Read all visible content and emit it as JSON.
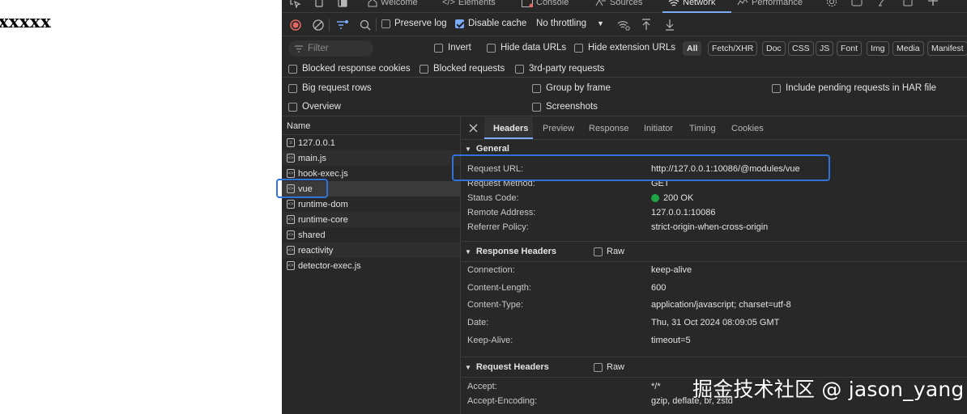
{
  "page": {
    "text": "xxxxx"
  },
  "devtools": {
    "tabs": [
      {
        "label": "Welcome",
        "icon": "home-icon"
      },
      {
        "label": "Elements",
        "icon": "code-icon"
      },
      {
        "label": "Console",
        "icon": "console-icon"
      },
      {
        "label": "Sources",
        "icon": "sources-icon"
      },
      {
        "label": "Network",
        "icon": "wifi-icon",
        "active": true
      },
      {
        "label": "Performance",
        "icon": "performance-icon"
      }
    ],
    "toolbar": {
      "preserve_log": "Preserve log",
      "disable_cache": "Disable cache",
      "throttling": "No throttling"
    },
    "filter": {
      "placeholder": "Filter",
      "invert": "Invert",
      "hide_data_urls": "Hide data URLs",
      "hide_extension_urls": "Hide extension URLs",
      "types": [
        "All",
        "Fetch/XHR",
        "Doc",
        "CSS",
        "JS",
        "Font",
        "Img",
        "Media",
        "Manifest"
      ],
      "blocked_response_cookies": "Blocked response cookies",
      "blocked_requests": "Blocked requests",
      "third_party_requests": "3rd-party requests"
    },
    "settings": {
      "big_request_rows": "Big request rows",
      "group_by_frame": "Group by frame",
      "include_pending": "Include pending requests in HAR file",
      "overview": "Overview",
      "screenshots": "Screenshots"
    },
    "requests": {
      "header": "Name",
      "items": [
        "127.0.0.1",
        "main.js",
        "hook-exec.js",
        "vue",
        "runtime-dom",
        "runtime-core",
        "shared",
        "reactivity",
        "detector-exec.js"
      ]
    },
    "details": {
      "tabs": [
        "Headers",
        "Preview",
        "Response",
        "Initiator",
        "Timing",
        "Cookies"
      ],
      "general": {
        "title": "General",
        "rows": [
          {
            "k": "Request URL:",
            "v": "http://127.0.0.1:10086/@modules/vue"
          },
          {
            "k": "Request Method:",
            "v": "GET"
          },
          {
            "k": "Status Code:",
            "v": "200 OK"
          },
          {
            "k": "Remote Address:",
            "v": "127.0.0.1:10086"
          },
          {
            "k": "Referrer Policy:",
            "v": "strict-origin-when-cross-origin"
          }
        ]
      },
      "response_headers": {
        "title": "Response Headers",
        "raw": "Raw",
        "rows": [
          {
            "k": "Connection:",
            "v": "keep-alive"
          },
          {
            "k": "Content-Length:",
            "v": "600"
          },
          {
            "k": "Content-Type:",
            "v": "application/javascript; charset=utf-8"
          },
          {
            "k": "Date:",
            "v": "Thu, 31 Oct 2024 08:09:05 GMT"
          },
          {
            "k": "Keep-Alive:",
            "v": "timeout=5"
          }
        ]
      },
      "request_headers": {
        "title": "Request Headers",
        "raw": "Raw",
        "rows": [
          {
            "k": "Accept:",
            "v": "*/*"
          },
          {
            "k": "Accept-Encoding:",
            "v": "gzip, deflate, br, zstd"
          }
        ]
      }
    }
  },
  "colors": {
    "accent": "#7cacf8",
    "highlight": "#2f73d8",
    "status_ok": "#1ea446",
    "record": "#e46962"
  },
  "watermark": "掘金技术社区 @ jason_yang"
}
